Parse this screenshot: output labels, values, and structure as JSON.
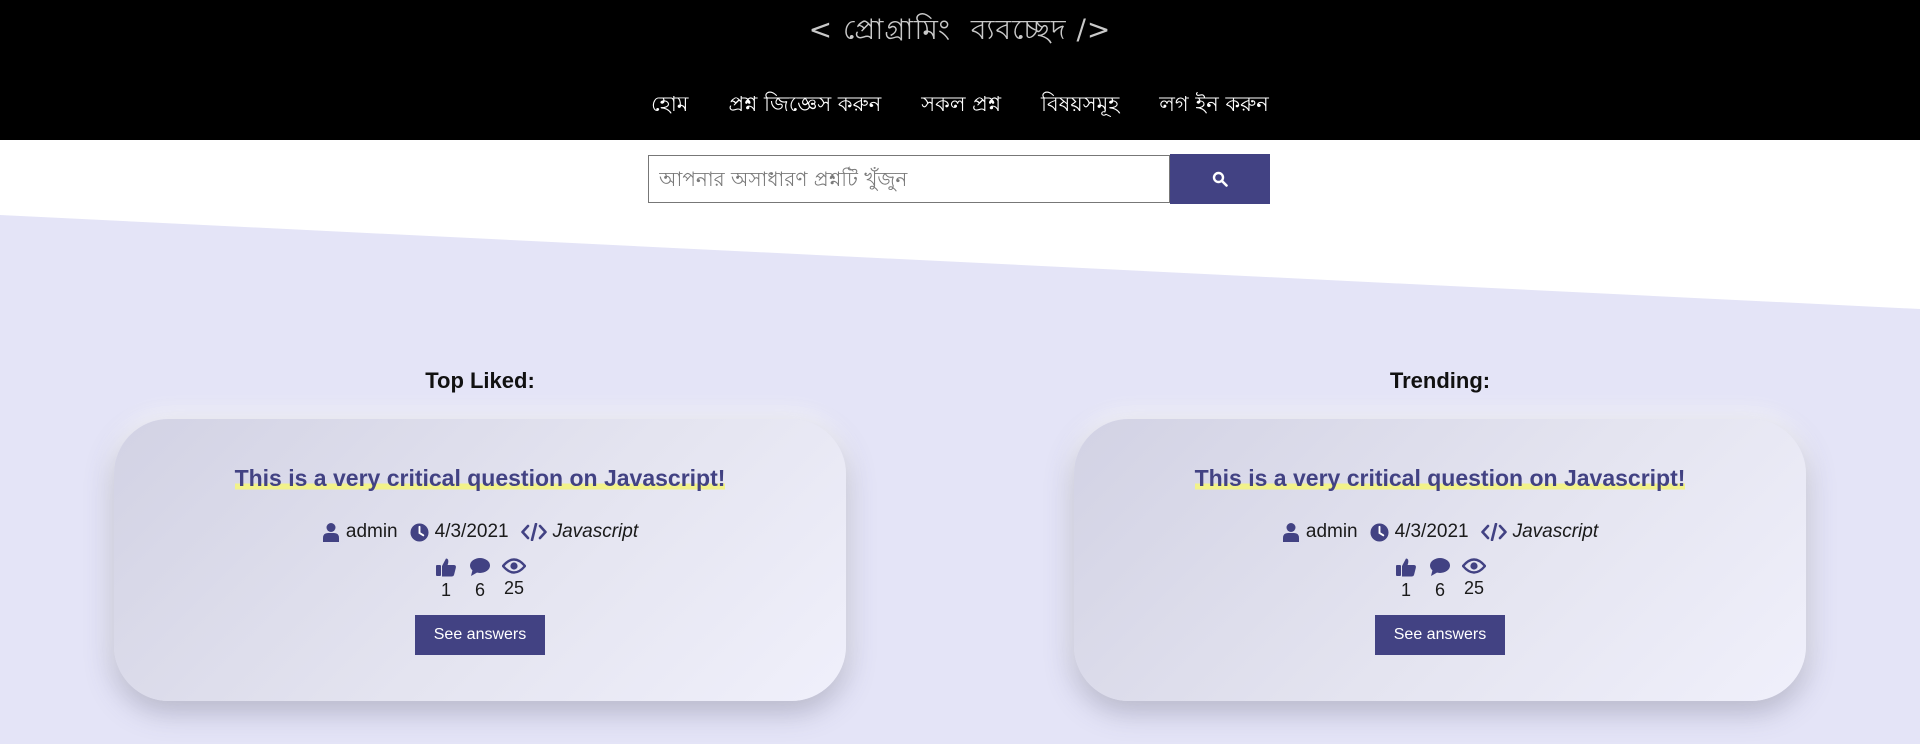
{
  "brand": {
    "title": "< প্রোগ্রামিং  ব্যবচ্ছেদ />"
  },
  "nav": {
    "items": [
      {
        "label": "হোম"
      },
      {
        "label": "প্রশ্ন জিজ্ঞেস করুন"
      },
      {
        "label": "সকল প্রশ্ন"
      },
      {
        "label": "বিষয়সমূহ"
      },
      {
        "label": "লগ ইন করুন"
      }
    ]
  },
  "search": {
    "placeholder": "আপনার অসাধারণ প্রশ্নটি খুঁজুন",
    "value": "",
    "button_icon": "search-icon"
  },
  "colors": {
    "accent": "#424283",
    "header_bg": "#000000",
    "page_bg": "#e4e4f7",
    "highlight": "#f2f28a"
  },
  "sections": [
    {
      "title": "Top Liked:",
      "card": {
        "question": "This is a very critical question on Javascript!",
        "author": "admin",
        "date": "4/3/2021",
        "topic": "Javascript",
        "likes": "1",
        "answers": "6",
        "views": "25",
        "button": "See answers"
      }
    },
    {
      "title": "Trending:",
      "card": {
        "question": "This is a very critical question on Javascript!",
        "author": "admin",
        "date": "4/3/2021",
        "topic": "Javascript",
        "likes": "1",
        "answers": "6",
        "views": "25",
        "button": "See answers"
      }
    }
  ]
}
